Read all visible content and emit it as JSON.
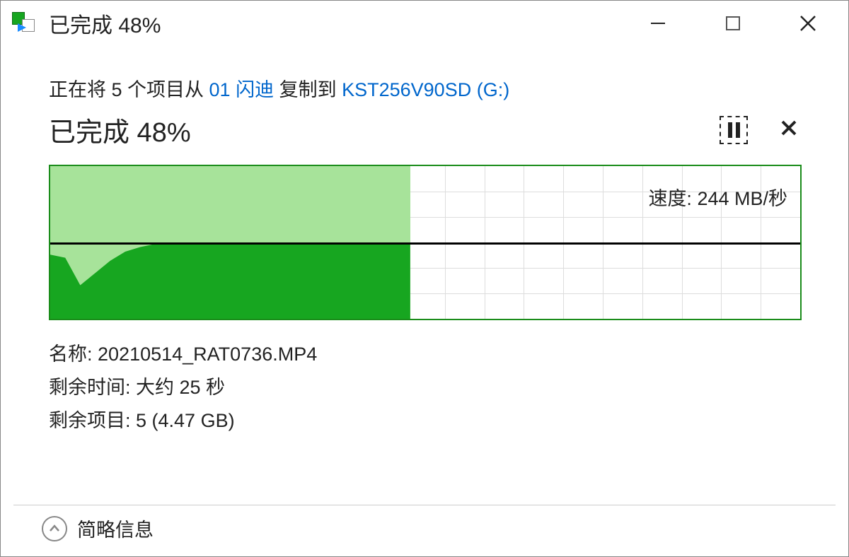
{
  "window": {
    "title": "已完成 48%"
  },
  "copy": {
    "prefix": "正在将 5 个项目从 ",
    "source": "01 闪迪",
    "mid": " 复制到 ",
    "dest": "KST256V90SD (G:)"
  },
  "progress": {
    "text": "已完成 48%",
    "percent": 48
  },
  "chart_data": {
    "type": "area",
    "progress_percent": 48,
    "midline_fraction": 0.5,
    "speed_label": "速度: 244 MB/秒",
    "x": [
      0,
      1,
      2,
      3,
      4,
      5,
      6,
      7,
      8,
      9,
      10,
      11,
      12,
      13,
      14,
      15,
      16,
      17,
      18,
      19,
      20,
      21,
      22,
      23,
      24
    ],
    "fill_fraction": [
      0.58,
      0.6,
      0.78,
      0.7,
      0.62,
      0.56,
      0.53,
      0.51,
      0.5,
      0.5,
      0.5,
      0.5,
      0.5,
      0.5,
      0.5,
      0.5,
      0.5,
      0.5,
      0.5,
      0.5,
      0.5,
      0.5,
      0.5,
      0.5,
      0.5
    ],
    "columns": 19,
    "rows": 6
  },
  "details": {
    "name_label": "名称: ",
    "name_value": "20210514_RAT0736.MP4",
    "time_label": "剩余时间: ",
    "time_value": "大约 25 秒",
    "items_label": "剩余项目: ",
    "items_value": "5 (4.47 GB)"
  },
  "footer": {
    "toggle": "简略信息"
  },
  "colors": {
    "accent_green": "#17a620",
    "light_green": "#a7e39a",
    "link": "#0066cc"
  }
}
